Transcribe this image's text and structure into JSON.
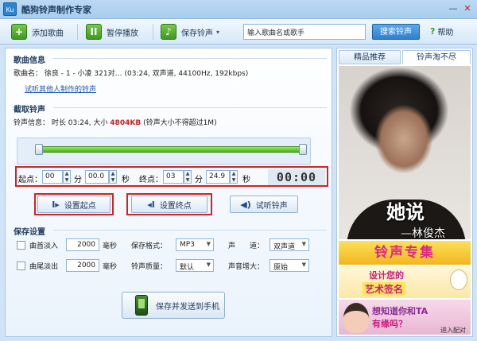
{
  "window": {
    "title": "酷狗铃声制作专家",
    "icon_label": "Ku",
    "minimize": "—",
    "close": "✕"
  },
  "toolbar": {
    "add_song": "添加歌曲",
    "pause": "暂停播放",
    "save_ringtone": "保存铃声",
    "search_placeholder": "输入歌曲名或歌手",
    "search_button": "搜索铃声",
    "help": "帮助"
  },
  "song_info": {
    "section_title": "歌曲信息",
    "song_name_label": "歌曲名：",
    "song_name_value": "徐良 - 1 - 小凌 321对…",
    "song_details": "(03:24, 双声道, 44100Hz,  192kbps)",
    "try_link": "试听其他人制作的铃声"
  },
  "cut": {
    "section_title": "截取铃声",
    "info_label": "铃声信息：",
    "duration_text": "时长 03:24, 大小",
    "size_value": "4804KB",
    "size_note": "(铃声大小不得超过1M)",
    "start_label": "起点：",
    "start_min": "00",
    "min_unit": "分",
    "start_sec": "00.0",
    "sec_unit": "秒",
    "end_label": "终点：",
    "end_min": "03",
    "end_sec": "24.9",
    "lcd": "00:00"
  },
  "actions": {
    "set_start": "设置起点",
    "set_end": "设置终点",
    "preview": "试听铃声"
  },
  "save_settings": {
    "section_title": "保存设置",
    "fade_in_label": "曲首淡入",
    "fade_in_value": "2000",
    "fade_out_label": "曲尾淡出",
    "fade_out_value": "2000",
    "ms_unit": "毫秒",
    "format_label": "保存格式：",
    "format_value": "MP3",
    "quality_label": "铃声质量：",
    "quality_value": "默认",
    "channel_label": "声　　道：",
    "channel_value": "双声道",
    "volume_label": "声音增大：",
    "volume_value": "原始",
    "save_send": "保存并发送到手机"
  },
  "side": {
    "tab_featured": "精品推荐",
    "tab_ringtone": "铃声淘不尽",
    "photo_title": "她说",
    "photo_artist": "—林俊杰",
    "ad_ringtone": "铃声专集",
    "ad_sign_1": "设计您的",
    "ad_sign_2": "艺术签名",
    "ad_girl_1": "想知道你和TA",
    "ad_girl_2": "有缘吗？",
    "ad_girl_3": "进入配对"
  },
  "colors": {
    "accent": "#2f7fcc",
    "highlight_border": "#d32222",
    "size_warning": "#d71c1c",
    "slider_green": "#46b51c"
  },
  "icons": {
    "add": "plus-icon",
    "pause": "pause-icon",
    "save": "music-note-icon",
    "help": "help-icon",
    "set_start": "start-marker-icon",
    "set_end": "end-marker-icon",
    "preview": "speaker-icon",
    "phone": "phone-icon"
  }
}
